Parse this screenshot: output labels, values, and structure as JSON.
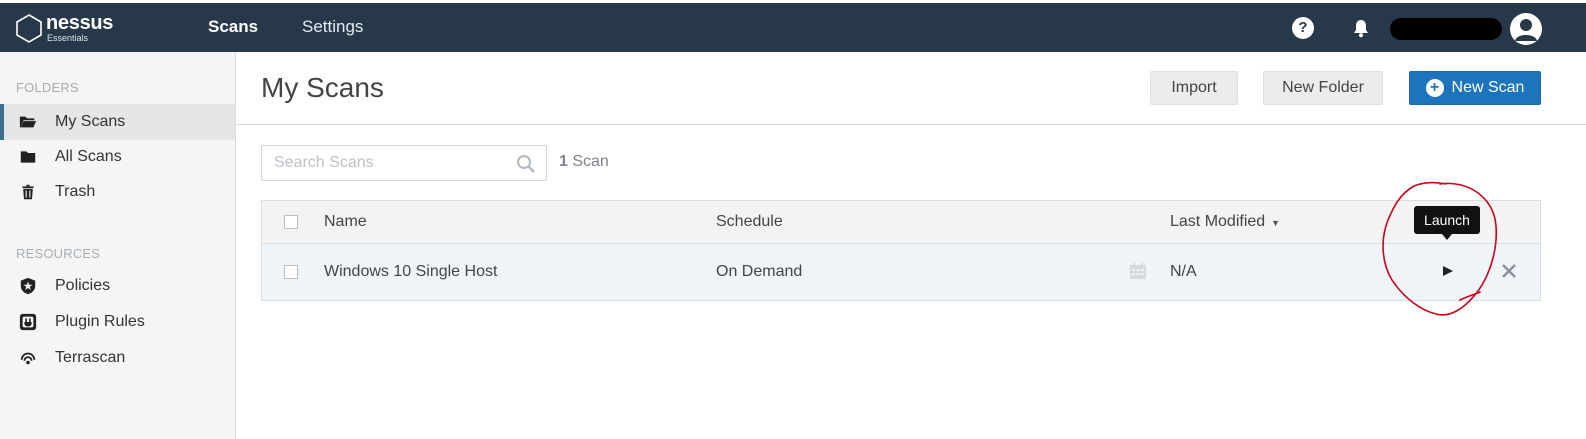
{
  "app": {
    "name": "nessus",
    "edition": "Essentials"
  },
  "topnav": {
    "items": [
      {
        "label": "Scans",
        "active": true
      },
      {
        "label": "Settings",
        "active": false
      }
    ],
    "help_label": "?"
  },
  "sidebar": {
    "folders_heading": "FOLDERS",
    "folders": [
      {
        "label": "My Scans",
        "icon": "folder-open-icon",
        "active": true
      },
      {
        "label": "All Scans",
        "icon": "folder-icon",
        "active": false
      },
      {
        "label": "Trash",
        "icon": "trash-icon",
        "active": false
      }
    ],
    "resources_heading": "RESOURCES",
    "resources": [
      {
        "label": "Policies",
        "icon": "shield-star-icon"
      },
      {
        "label": "Plugin Rules",
        "icon": "plug-icon"
      },
      {
        "label": "Terrascan",
        "icon": "radar-icon"
      }
    ]
  },
  "main": {
    "title": "My Scans",
    "buttons": {
      "import": "Import",
      "new_folder": "New Folder",
      "new_scan": "New Scan"
    },
    "search": {
      "placeholder": "Search Scans",
      "value": ""
    },
    "scan_count": {
      "number": "1",
      "label": "Scan"
    },
    "table": {
      "columns": {
        "name": "Name",
        "schedule": "Schedule",
        "last_modified": "Last Modified"
      },
      "rows": [
        {
          "name": "Windows 10 Single Host",
          "schedule": "On Demand",
          "last_modified": "N/A"
        }
      ]
    },
    "tooltip": "Launch"
  },
  "colors": {
    "topbar": "#263849",
    "accent": "#1c75bc",
    "annotation": "#d0021b"
  }
}
